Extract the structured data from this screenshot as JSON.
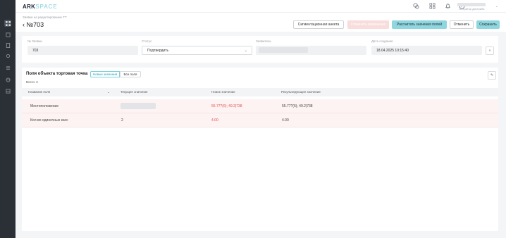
{
  "app": {
    "logo_main": "ARK",
    "logo_sub": "SPACE"
  },
  "user": {
    "role": "Оператор дистрибь"
  },
  "header": {
    "breadcrumb": "Заявки на редактирование ТТ",
    "back_icon": "‹",
    "title": "№703"
  },
  "buttons": {
    "segmentation": "Сигментационная анкета",
    "pink": "Отменить изменения",
    "calc": "Рассчитать значения полей",
    "cancel": "Отменить",
    "save": "Сохранить"
  },
  "form": {
    "num_label": "№ Заявки",
    "num_value": "703",
    "status_label": "Статус",
    "status_value": "Подтвердить",
    "applicant_label": "Заявитель",
    "date_label": "Дата создания",
    "date_value": "18.04.2025 10:15:40"
  },
  "section": {
    "title": "Поля объекта торговая точка",
    "toggle_new": "Новые значения",
    "toggle_all": "Все поля",
    "total": "Всего: 2"
  },
  "table": {
    "headers": [
      "Название поля",
      "Текущее значение",
      "Новое значение",
      "Результирующее значение"
    ],
    "rows": [
      {
        "name": "Местоположение",
        "new": "55.77?(6); 49.2|738",
        "result": "55.77?(6); 49.2|738"
      },
      {
        "name": "Кол-во одиночных касс",
        "current": "2",
        "new": "4.00",
        "result": "4.00"
      }
    ]
  },
  "colors": {
    "accent": "#8fd6de",
    "accent_text": "#17a2b8",
    "danger": "#e5534b",
    "rail": "#2b2f36",
    "row_bg": "#fdf3f3"
  },
  "icons": {
    "rail": [
      "grid-icon",
      "layers-icon",
      "file-icon",
      "settings-icon",
      "list-icon",
      "globe-icon",
      "table-icon"
    ],
    "top": [
      "chat-icon",
      "apps-icon",
      "bell-icon",
      "compass-icon"
    ]
  }
}
